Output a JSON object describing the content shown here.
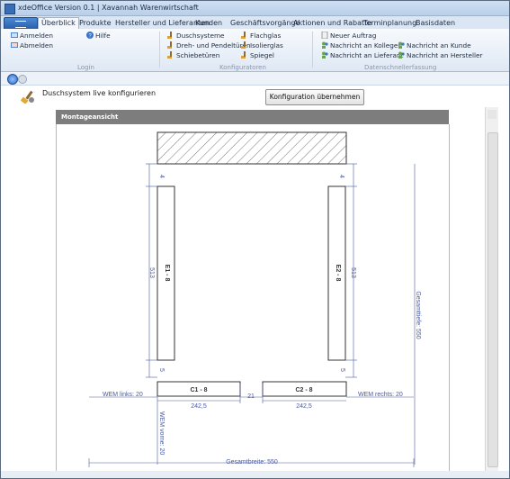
{
  "window": {
    "title": "xdeOffice Version 0.1 | Xavannah Warenwirtschaft"
  },
  "tabs": [
    {
      "label": "Überblick",
      "active": true
    },
    {
      "label": "Produkte"
    },
    {
      "label": "Hersteller und Lieferanten"
    },
    {
      "label": "Kunden"
    },
    {
      "label": "Geschäftsvorgänge"
    },
    {
      "label": "Aktionen und Rabatte"
    },
    {
      "label": "Terminplanung"
    },
    {
      "label": "Basisdaten"
    }
  ],
  "ribbon": {
    "login": {
      "anmelden": "Anmelden",
      "abmelden": "Abmelden",
      "hilfe": "Hilfe",
      "group": "Login"
    },
    "konfiguratoren": {
      "duschsysteme": "Duschsysteme",
      "dreh": "Dreh- und Pendeltüren",
      "schiebe": "Schiebetüren",
      "flachglas": "Flachglas",
      "isolierglas": "Isolierglas",
      "spiegel": "Spiegel",
      "group": "Konfiguratoren"
    },
    "daten": {
      "neuer_auftrag": "Neuer Auftrag",
      "nachricht_kollegen": "Nachricht an Kollegen",
      "nachricht_lieferant": "Nachricht an Lieferant",
      "nachricht_kunde": "Nachricht an Kunde",
      "nachricht_hersteller": "Nachricht an Hersteller",
      "group": "Datenschnellerfassung"
    }
  },
  "page": {
    "title": "Duschsystem live konfigurieren",
    "apply_button": "Konfiguration übernehmen",
    "panel_title": "Montageansicht"
  },
  "drawing": {
    "e1": "E1 - 8",
    "e2": "E2 - 8",
    "c1": "C1 - 8",
    "c2": "C2 - 8",
    "dim_513_left": "513",
    "dim_513_right": "513",
    "dim_4_left": "4",
    "dim_4_right": "4",
    "dim_5_left": "5",
    "dim_5_right": "5",
    "dim_21": "21",
    "dim_242_left": "242,5",
    "dim_242_right": "242,5",
    "wem_links": "WEM links: 20",
    "wem_rechts": "WEM rechts: 20",
    "wem_vorne": "WEM vorne: 20",
    "gesamttiefe": "Gesamttiefe: 550",
    "gesamtbreite": "Gesamtbreite: 550"
  },
  "colors": {
    "dimension": "#4a5aa0",
    "accent": "#2a5fab"
  }
}
